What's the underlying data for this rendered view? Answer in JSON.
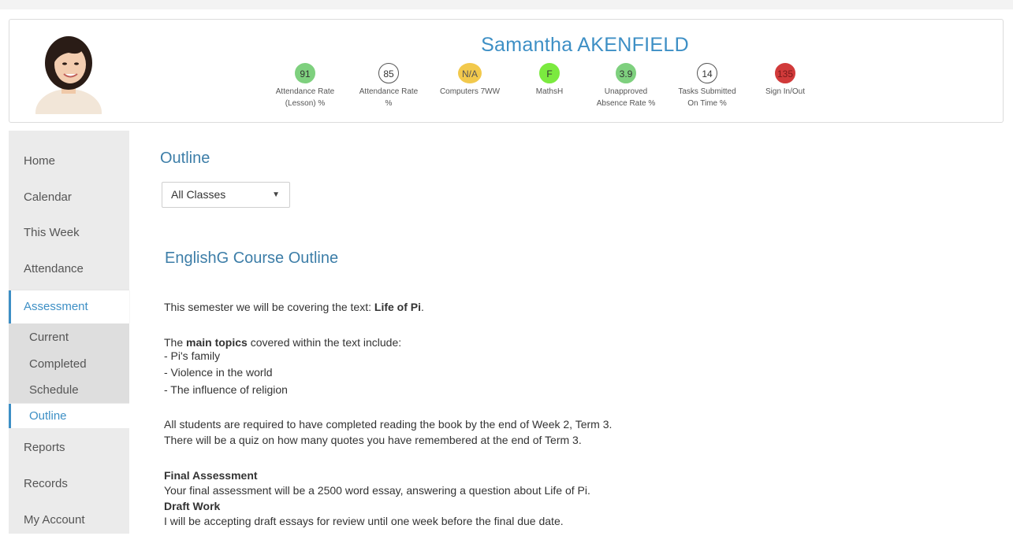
{
  "student": {
    "name": "Samantha AKENFIELD"
  },
  "metrics": [
    {
      "value": "91",
      "label1": "Attendance Rate",
      "label2": "(Lesson) %",
      "color": "#7ed07e",
      "border": "#7ed07e",
      "text": "#333"
    },
    {
      "value": "85",
      "label1": "Attendance Rate",
      "label2": "%",
      "color": "#ffffff",
      "border": "#555555",
      "text": "#333"
    },
    {
      "value": "N/A",
      "label1": "Computers 7WW",
      "label2": "",
      "color": "#f2c94c",
      "border": "#f2c94c",
      "text": "#555"
    },
    {
      "value": "F",
      "label1": "MathsH",
      "label2": "",
      "color": "#7bea3f",
      "border": "#7bea3f",
      "text": "#333"
    },
    {
      "value": "3.9",
      "label1": "Unapproved",
      "label2": "Absence Rate %",
      "color": "#7ed07e",
      "border": "#7ed07e",
      "text": "#333"
    },
    {
      "value": "14",
      "label1": "Tasks Submitted",
      "label2": "On Time %",
      "color": "#ffffff",
      "border": "#555555",
      "text": "#333"
    },
    {
      "value": "135",
      "label1": "Sign In/Out",
      "label2": "",
      "color": "#d13a3a",
      "border": "#d13a3a",
      "text": "#7a1a1a"
    }
  ],
  "nav": {
    "home": "Home",
    "calendar": "Calendar",
    "this_week": "This Week",
    "attendance": "Attendance",
    "assessment": "Assessment",
    "sub": {
      "current": "Current",
      "completed": "Completed",
      "schedule": "Schedule",
      "outline": "Outline"
    },
    "reports": "Reports",
    "records": "Records",
    "my_account": "My Account"
  },
  "page": {
    "title": "Outline",
    "class_select": "All Classes",
    "course_title": "EnglishG Course Outline",
    "intro_prefix": "This semester we will be covering the text: ",
    "intro_book": "Life of Pi",
    "intro_suffix": ".",
    "topics_prefix": "The ",
    "topics_bold": "main topics",
    "topics_suffix": " covered within the text include:",
    "topic_1": "- Pi's family",
    "topic_2": "- Violence in the world",
    "topic_3": "- The influence of religion",
    "req_line_1": "All students are required to have completed reading the book by the end of Week 2, Term 3.",
    "req_line_2": "There will be a quiz on how many quotes you have remembered at the end of Term 3.",
    "final_heading": "Final Assessment",
    "final_text": "Your final assessment will be a 2500 word essay, answering a question about Life of Pi.",
    "draft_heading": "Draft Work",
    "draft_text": "I will be accepting draft essays for review until one week before the final due date."
  },
  "colors": {
    "accent": "#3d8fc5",
    "sidebar_bg": "#ebebeb"
  }
}
